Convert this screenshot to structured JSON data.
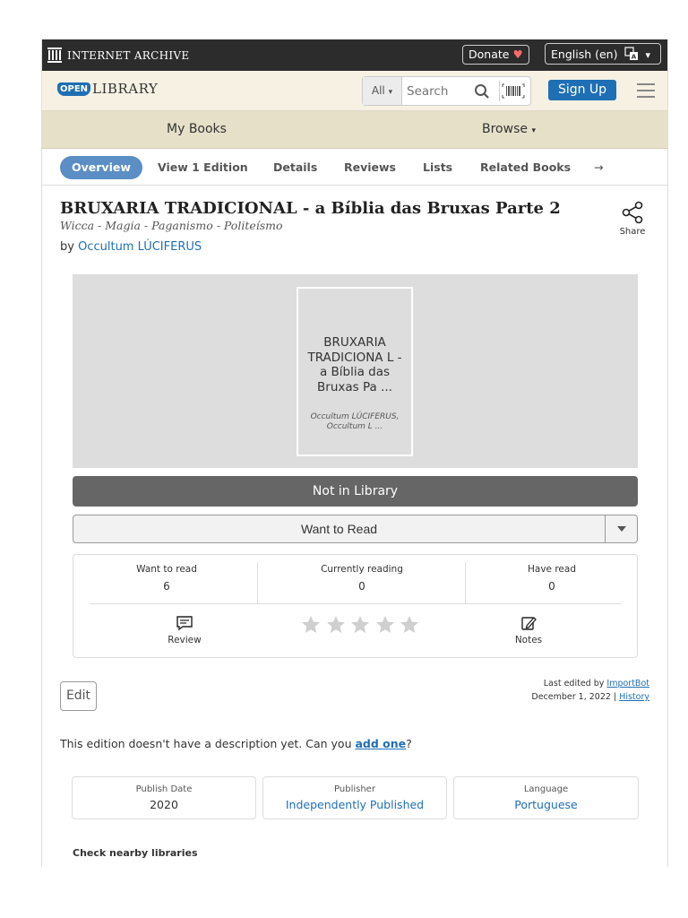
{
  "ia_bar": {
    "logo_text": "INTERNET ARCHIVE",
    "donate_label": "Donate",
    "donate_heart": "♥",
    "language_label": "English (en)",
    "language_caret": "▾"
  },
  "ol_bar": {
    "logo_open": "OPEN",
    "logo_library": "LIBRARY",
    "search_scope": "All",
    "search_scope_caret": "▾",
    "search_placeholder": "Search",
    "signup_label": "Sign Up"
  },
  "nav": {
    "my_books": "My Books",
    "browse": "Browse",
    "browse_caret": "▾"
  },
  "tabs": [
    {
      "label": "Overview"
    },
    {
      "label": "View 1 Edition"
    },
    {
      "label": "Details"
    },
    {
      "label": "Reviews"
    },
    {
      "label": "Lists"
    },
    {
      "label": "Related Books"
    }
  ],
  "tabs_more": "→",
  "book": {
    "title": "BRUXARIA TRADICIONAL - a Bíblia das Bruxas Parte 2",
    "subtitle": "Wicca - Magia - Paganismo - Politeísmo",
    "by": "by",
    "author": "Occultum LÚCIFERUS",
    "share_label": "Share",
    "cover_title": "BRUXARIA TRADICIONA L - a Bíblia das Bruxas Pa ...",
    "cover_author": "Occultum LÚCIFERUS, Occultum L ..."
  },
  "actions": {
    "not_in_library": "Not in Library",
    "want_to_read": "Want to Read"
  },
  "stats": {
    "want_to_read_label": "Want to read",
    "want_to_read_count": "6",
    "currently_reading_label": "Currently reading",
    "currently_reading_count": "0",
    "have_read_label": "Have read",
    "have_read_count": "0",
    "review_label": "Review",
    "notes_label": "Notes",
    "rating_stars_filled": 0,
    "rating_stars_total": 5
  },
  "edit": {
    "edit_label": "Edit",
    "last_edited_by": "Last edited by",
    "editor": "ImportBot",
    "date": "December 1, 2022",
    "separator": "|",
    "history": "History"
  },
  "description": {
    "text": "This edition doesn't have a description yet. Can you",
    "link": "add one",
    "end": "?"
  },
  "meta": {
    "publish_date_label": "Publish Date",
    "publish_date": "2020",
    "publisher_label": "Publisher",
    "publisher": "Independently Published",
    "language_label": "Language",
    "language": "Portuguese"
  },
  "nearby": {
    "heading": "Check nearby libraries"
  },
  "colors": {
    "ia_bar": "#2c2c2c",
    "ol_bar": "#f6f1e3",
    "nav_bar": "#e6e0c9",
    "link": "#1f6fb4",
    "active_tab": "#5b8ec5",
    "not_in_library": "#666666"
  }
}
